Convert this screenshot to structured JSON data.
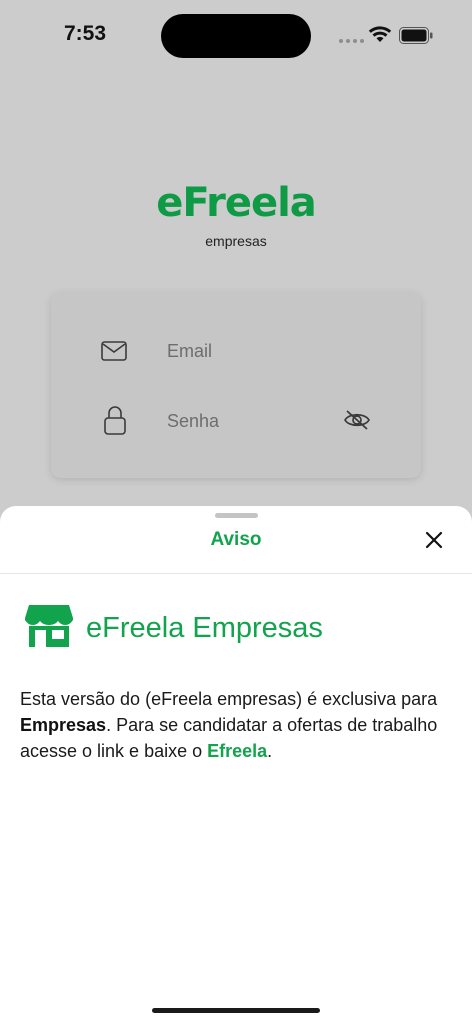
{
  "status_bar": {
    "time": "7:53",
    "icons": [
      "signal-dots-icon",
      "wifi-icon",
      "battery-icon"
    ]
  },
  "login": {
    "brand": "eFreela",
    "brand_sub": "empresas",
    "email_placeholder": "Email",
    "password_placeholder": "Senha",
    "icons": [
      "mail-icon",
      "lock-icon",
      "eye-off-icon"
    ]
  },
  "sheet": {
    "title": "Aviso",
    "app_name": "eFreela Empresas",
    "notice": {
      "part1": "Esta versão do (eFreela empresas) é exclusiva para ",
      "bold1": "Empresas",
      "part2": ". Para se candidatar a ofertas de trabalho acesse o link e baixe o ",
      "link": "Efreela",
      "part3": "."
    },
    "icons": [
      "close-icon",
      "store-icon"
    ]
  },
  "colors": {
    "brand_green": "#0f9a46",
    "accent_green": "#12a34d",
    "overlay_gray": "#cccccc"
  }
}
